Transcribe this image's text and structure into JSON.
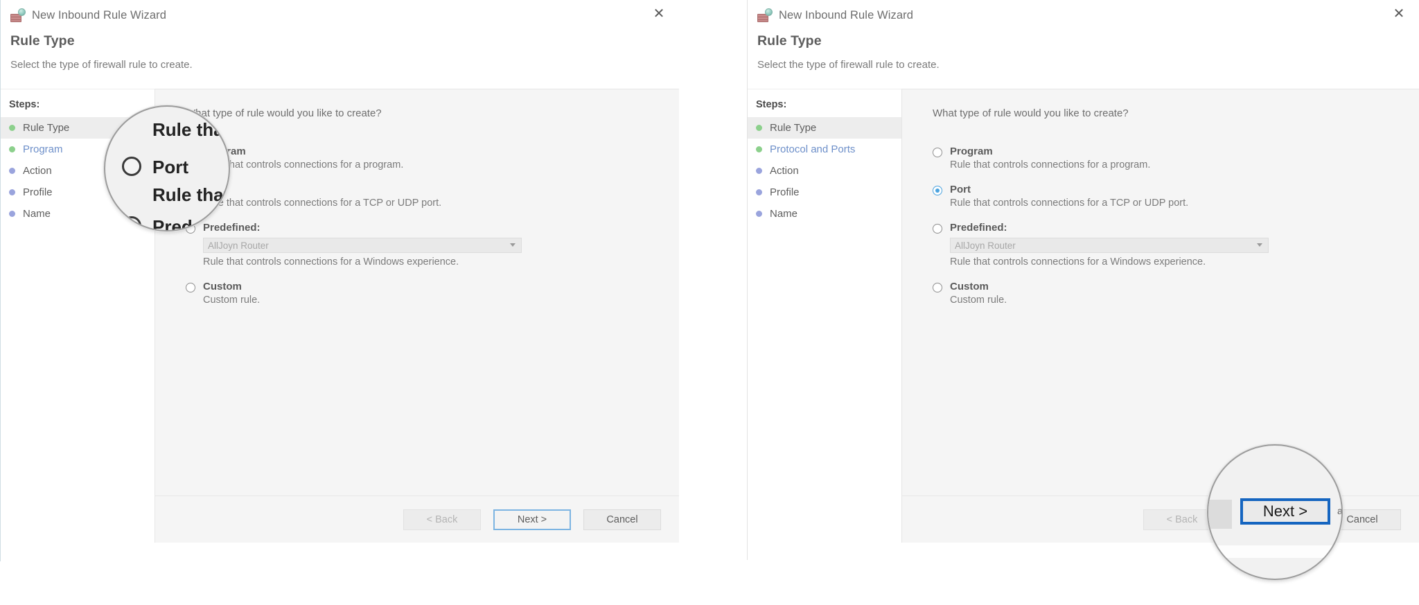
{
  "meta": {
    "accent_blue": "#4aa3df",
    "focus_blue": "#7cb4e2",
    "magnifier_blue": "#1565c0",
    "step_done_green": "#8cd08c",
    "step_pending_blue": "#9aa4dd",
    "panel_bg": "#f5f5f5"
  },
  "left_dialog": {
    "titlebar": {
      "title": "New Inbound Rule Wizard",
      "icon": "firewall-brick-globe-icon",
      "close_label": "✕"
    },
    "header": {
      "title": "Rule Type",
      "subtitle": "Select the type of firewall rule to create."
    },
    "steps": {
      "heading": "Steps:",
      "items": [
        {
          "label": "Rule Type",
          "dot": "green",
          "state": "active"
        },
        {
          "label": "Program",
          "dot": "green",
          "state": "link"
        },
        {
          "label": "Action",
          "dot": "blue",
          "state": "normal"
        },
        {
          "label": "Profile",
          "dot": "blue",
          "state": "normal"
        },
        {
          "label": "Name",
          "dot": "blue",
          "state": "normal"
        }
      ]
    },
    "content": {
      "question": "What type of rule would you like to create?",
      "options": [
        {
          "label": "Program",
          "desc": "Rule that controls connections for a program.",
          "selected": false
        },
        {
          "label": "Port",
          "desc": "Rule that controls connections for a TCP or UDP port.",
          "selected": false
        },
        {
          "label": "Predefined:",
          "desc": "Rule that controls connections for a Windows experience.",
          "selected": false,
          "combo_value": "AllJoyn Router"
        },
        {
          "label": "Custom",
          "desc": "Custom rule.",
          "selected": false
        }
      ]
    },
    "footer": {
      "back": "< Back",
      "next": "Next >",
      "cancel": "Cancel"
    },
    "magnifier": {
      "name": "port-option-magnifier",
      "line1": "Rule that",
      "line2": "Port",
      "line3": "Rule that co",
      "line4": "Predefi"
    }
  },
  "right_dialog": {
    "titlebar": {
      "title": "New Inbound Rule Wizard",
      "icon": "firewall-brick-globe-icon",
      "close_label": "✕"
    },
    "header": {
      "title": "Rule Type",
      "subtitle": "Select the type of firewall rule to create."
    },
    "steps": {
      "heading": "Steps:",
      "items": [
        {
          "label": "Rule Type",
          "dot": "green",
          "state": "active"
        },
        {
          "label": "Protocol and Ports",
          "dot": "green",
          "state": "link"
        },
        {
          "label": "Action",
          "dot": "blue",
          "state": "normal"
        },
        {
          "label": "Profile",
          "dot": "blue",
          "state": "normal"
        },
        {
          "label": "Name",
          "dot": "blue",
          "state": "normal"
        }
      ]
    },
    "content": {
      "question": "What type of rule would you like to create?",
      "options": [
        {
          "label": "Program",
          "desc": "Rule that controls connections for a program.",
          "selected": false
        },
        {
          "label": "Port",
          "desc": "Rule that controls connections for a TCP or UDP port.",
          "selected": true
        },
        {
          "label": "Predefined:",
          "desc": "Rule that controls connections for a Windows experience.",
          "selected": false,
          "combo_value": "AllJoyn Router"
        },
        {
          "label": "Custom",
          "desc": "Custom rule.",
          "selected": false
        }
      ]
    },
    "footer": {
      "back": "< Back",
      "next": "Next >",
      "cancel": "Cancel"
    },
    "magnifier": {
      "name": "next-button-magnifier",
      "next_label": "Next >",
      "cancel_fragment": "ancel"
    }
  }
}
